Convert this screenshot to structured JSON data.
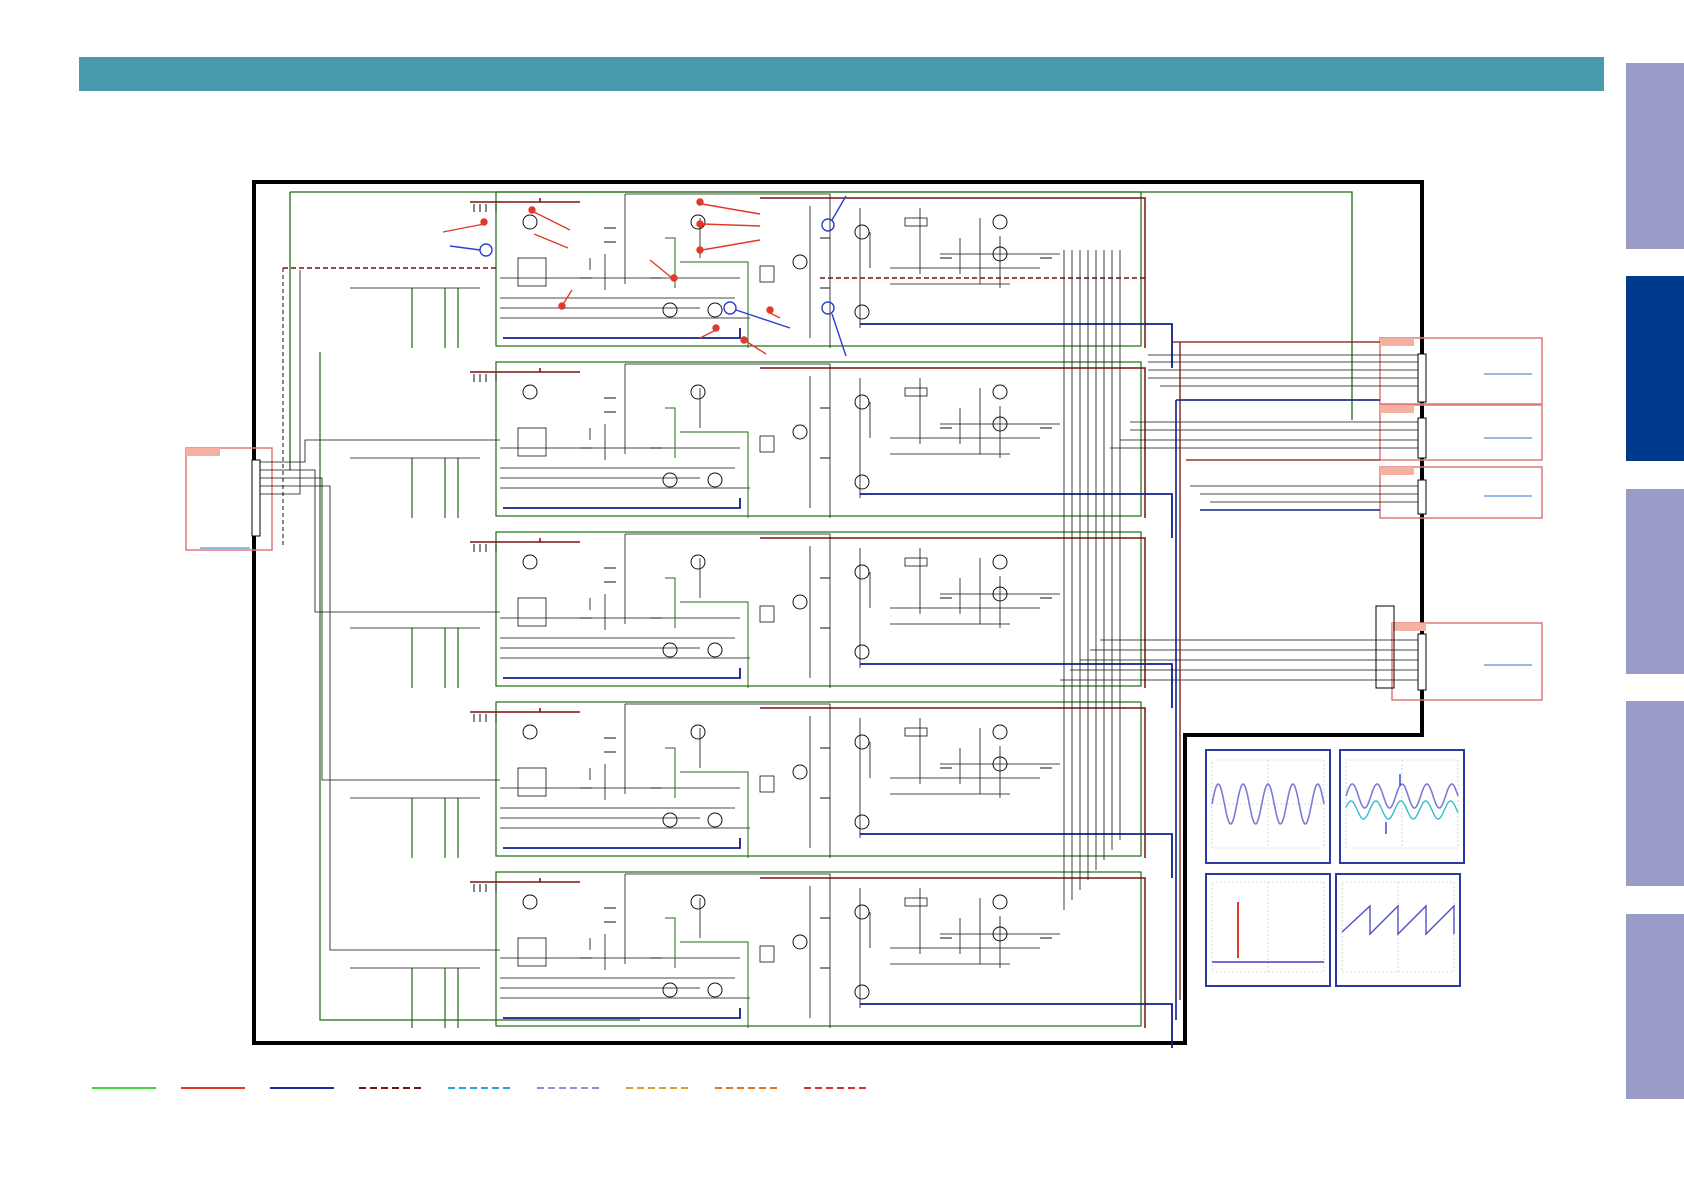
{
  "header": {
    "title": ""
  },
  "side_tabs": [
    {
      "name": "tab-1",
      "label": "",
      "active": false
    },
    {
      "name": "tab-2",
      "label": "",
      "active": true
    },
    {
      "name": "tab-3",
      "label": "",
      "active": false
    },
    {
      "name": "tab-4",
      "label": "",
      "active": false
    },
    {
      "name": "tab-5",
      "label": "",
      "active": false
    }
  ],
  "colors": {
    "header": "#4a9aae",
    "tab": "#9b9bc8",
    "tab_active": "#003a8c",
    "wire": "#111111",
    "rail_positive": "#7a1010",
    "ground": "#1f6b10",
    "rail_negative": "#10208a",
    "annotation_red": "#e03a2a",
    "annotation_blue": "#2a40d0",
    "connector": "#e07878",
    "scope_frame": "#2a3aa0"
  },
  "channels": 5,
  "legend": [
    {
      "style": "solid",
      "color": "#3fd53f"
    },
    {
      "style": "solid",
      "color": "#e03a2a"
    },
    {
      "style": "solid",
      "color": "#1a2aa0"
    },
    {
      "style": "dashed",
      "color": "#7a1010"
    },
    {
      "style": "dashed",
      "color": "#22a8d8"
    },
    {
      "style": "dashed",
      "color": "#9a8ad8"
    },
    {
      "style": "dashed",
      "color": "#d8a030"
    },
    {
      "style": "dashed",
      "color": "#e07818"
    },
    {
      "style": "dashed",
      "color": "#d83030"
    }
  ],
  "scopes": [
    {
      "name": "scope-sine",
      "waveform": "sine",
      "trace_color": "#7c7cd8"
    },
    {
      "name": "scope-dual-sine",
      "waveform": "dual-sine",
      "trace_color": "#7c7cd8",
      "trace2_color": "#30c0c8"
    },
    {
      "name": "scope-dc",
      "waveform": "flat",
      "trace_color": "#4040c0"
    },
    {
      "name": "scope-sawtooth",
      "waveform": "sawtooth",
      "trace_color": "#5050c8"
    }
  ]
}
